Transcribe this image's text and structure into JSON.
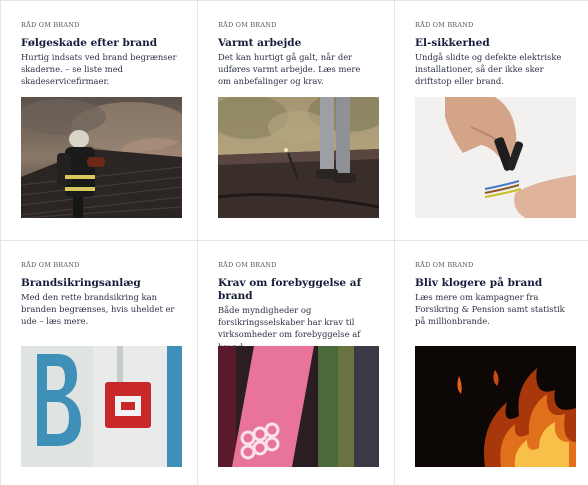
{
  "cards": [
    {
      "eyebrow": "RÅD OM BRAND",
      "title": "Følgeskade efter brand",
      "desc": "Hurtig indsats ved brand begrænser skaderne. – se liste med skadeservicefirmaer.",
      "image_icon": "firefighter-roof-image"
    },
    {
      "eyebrow": "RÅD OM BRAND",
      "title": "Varmt arbejde",
      "desc": "Det kan hurtigt gå galt, når der udføres varmt arbejde. Læs mere om anbefalinger og krav.",
      "image_icon": "roofer-torch-image"
    },
    {
      "eyebrow": "RÅD OM BRAND",
      "title": "El-sikkerhed",
      "desc": "Undgå slidte og defekte elektriske installationer, så der ikke sker driftstop eller brand.",
      "image_icon": "wire-stripping-image"
    },
    {
      "eyebrow": "RÅD OM BRAND",
      "title": "Brandsikringsanlæg",
      "desc": "Med den rette brandsikring kan branden begrænses, hvis uheldet er ude – læs mere.",
      "image_icon": "fire-alarm-image"
    },
    {
      "eyebrow": "RÅD OM BRAND",
      "title": "Krav om forebyggelse af brand",
      "desc": "Både myndigheder og forsikringsselskaber har krav til virksomheder om forebyggelse af brand.",
      "image_icon": "binders-image"
    },
    {
      "eyebrow": "RÅD OM BRAND",
      "title": "Bliv klogere på brand",
      "desc": "Læs mere om kampagner fra Forsikring & Pension samt statistik på millionbrande.",
      "image_icon": "flames-image"
    }
  ],
  "colors": {
    "title": "#141c3a",
    "text": "#2b3145",
    "eyebrow": "#555a66",
    "border": "#e6e6e6"
  }
}
